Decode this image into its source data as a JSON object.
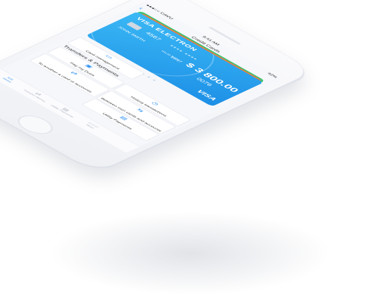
{
  "status": {
    "carrier": "●●●○○ CAVU",
    "time": "9:41 AM",
    "battery": "42%"
  },
  "nav": {
    "title": "Credit Cards",
    "back_icon": "chevron-left-icon"
  },
  "card": {
    "brand": "VISA ELECTRON",
    "number_first": "4567",
    "masked": "**** ****",
    "last4": "0076",
    "holder": "JOHN SMITH",
    "valid_label": "VALID THRU",
    "valid": "12/17",
    "balance": "$ 3 800.00",
    "network": "VISA",
    "color": "#1d8fe6"
  },
  "pager": {
    "count": 5,
    "active": 0
  },
  "tiles": {
    "card_management": "Card management",
    "section_title": "Transfers & Payments",
    "pay_my_dues": "Pay my Dues",
    "history": "History transactions",
    "to_another": "To another a card or accounts",
    "between_own": "Between own cards and accounts",
    "utility": "Utility Payments"
  },
  "tabs": [
    {
      "label": "Home",
      "icon": "home-icon"
    },
    {
      "label": "Transfer Money",
      "icon": "transfer-icon"
    },
    {
      "label": "Utility Payments",
      "icon": "receipt-icon"
    },
    {
      "label": "More",
      "icon": "more-icon"
    }
  ],
  "colors": {
    "accent": "#2b8ef0",
    "card_green": "#3cc374",
    "card_orange": "#f07a3c"
  }
}
